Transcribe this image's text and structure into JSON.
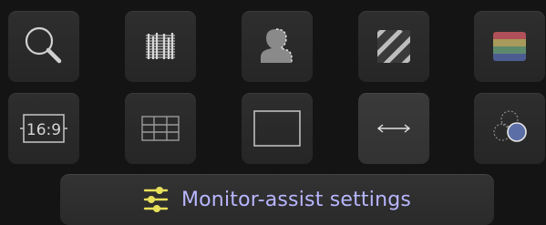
{
  "tools": {
    "row1": [
      {
        "name": "zoom-magnify",
        "icon": "magnifier-icon"
      },
      {
        "name": "waveform",
        "icon": "waveform-icon"
      },
      {
        "name": "peaking",
        "icon": "peaking-silhouette-icon"
      },
      {
        "name": "zebra",
        "icon": "zebra-stripes-icon"
      },
      {
        "name": "false-color",
        "icon": "false-color-icon"
      }
    ],
    "row2": [
      {
        "name": "aspect-ratio",
        "icon": "aspect-ratio-icon",
        "label": "16:9"
      },
      {
        "name": "grid",
        "icon": "grid-icon"
      },
      {
        "name": "frame-guide",
        "icon": "frame-guide-icon"
      },
      {
        "name": "desqueeze",
        "icon": "double-arrow-icon"
      },
      {
        "name": "monochrome",
        "icon": "color-channels-icon"
      }
    ]
  },
  "settings_button": {
    "label": "Monitor-assist settings",
    "icon": "sliders-icon"
  },
  "colors": {
    "background": "#141414",
    "tile": "#2a2a2a",
    "icon": "#bdbdbd",
    "accent_yellow": "#e8e05a",
    "label": "#b8b6ff",
    "monochrome_fill": "#5b6fa6"
  }
}
